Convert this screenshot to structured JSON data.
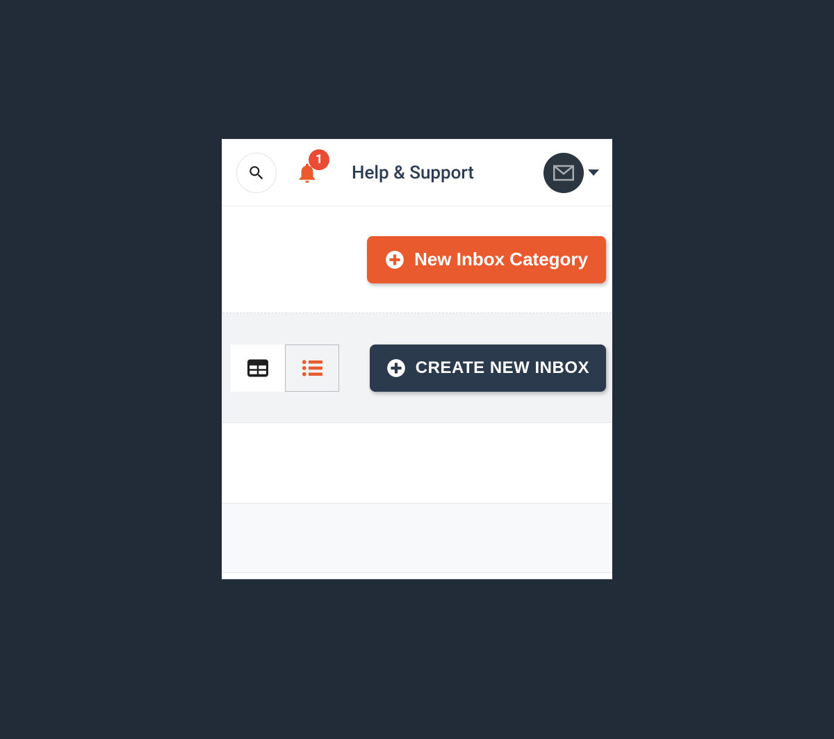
{
  "header": {
    "notification_count": "1",
    "help_label": "Help & Support"
  },
  "actions": {
    "new_category_label": "New Inbox Category",
    "create_inbox_label": "CREATE NEW INBOX"
  }
}
